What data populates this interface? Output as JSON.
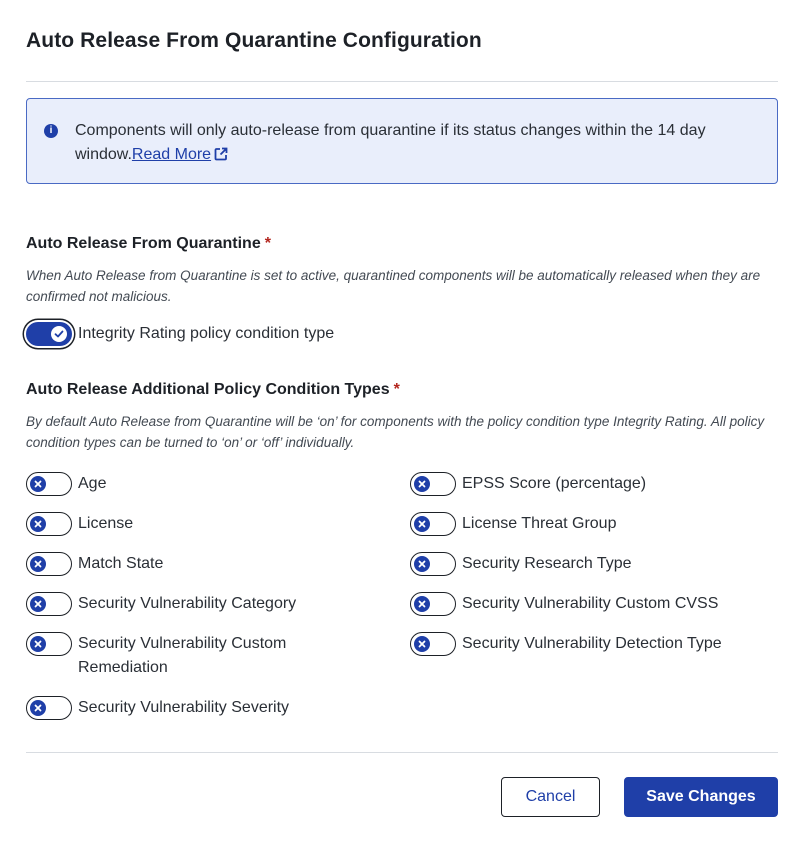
{
  "dialog": {
    "title": "Auto Release From Quarantine Configuration"
  },
  "alert": {
    "text": "Components will only auto-release from quarantine if its status changes within the 14 day window.",
    "link_label": "Read More",
    "icon": "info-icon"
  },
  "auto_release": {
    "label": "Auto Release From Quarantine",
    "required_mark": "*",
    "description": "When Auto Release from Quarantine is set to active, quarantined components will be automatically released when they are confirmed not malicious.",
    "toggle_label": "Integrity Rating policy condition type",
    "toggle_state": "on"
  },
  "additional": {
    "label": "Auto Release Additional Policy Condition Types",
    "required_mark": "*",
    "description": "By default Auto Release from Quarantine will be ‘on’ for components with the policy condition type Integrity Rating. All policy condition types can be turned to ‘on’ or ‘off’ individually.",
    "left_items": [
      {
        "label": "Age",
        "state": "off"
      },
      {
        "label": "License",
        "state": "off"
      },
      {
        "label": "Match State",
        "state": "off"
      },
      {
        "label": "Security Vulnerability Category",
        "state": "off"
      },
      {
        "label": "Security Vulnerability Custom Remediation",
        "state": "off"
      },
      {
        "label": "Security Vulnerability Severity",
        "state": "off"
      }
    ],
    "right_items": [
      {
        "label": "EPSS Score (percentage)",
        "state": "off"
      },
      {
        "label": "License Threat Group",
        "state": "off"
      },
      {
        "label": "Security Research Type",
        "state": "off"
      },
      {
        "label": "Security Vulnerability Custom CVSS",
        "state": "off"
      },
      {
        "label": "Security Vulnerability Detection Type",
        "state": "off"
      }
    ]
  },
  "footer": {
    "cancel_label": "Cancel",
    "save_label": "Save Changes"
  },
  "colors": {
    "accent": "#1f3fa8",
    "alert_bg": "#e9eefb",
    "required": "#b3261e"
  }
}
